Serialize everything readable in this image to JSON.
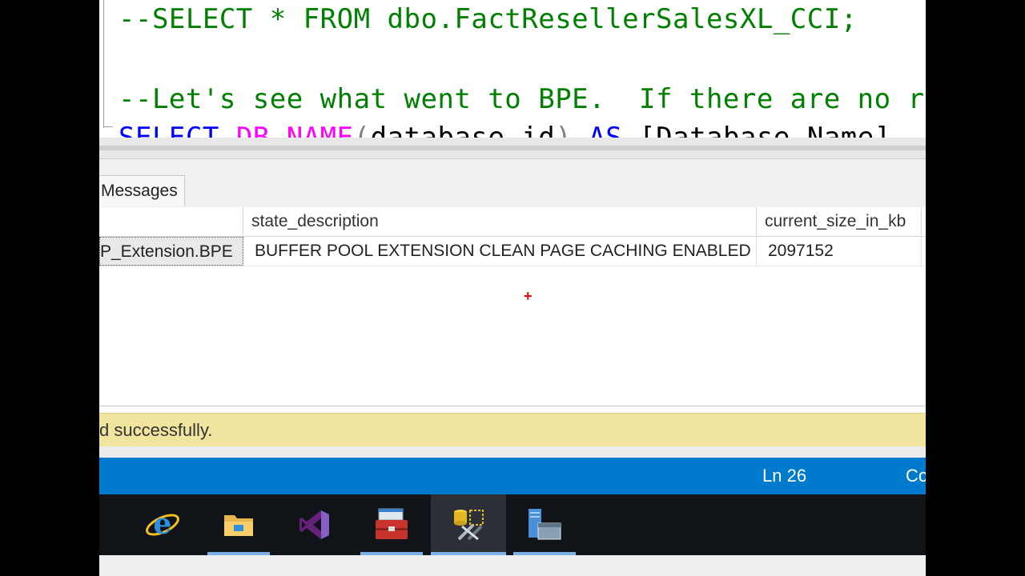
{
  "editor": {
    "line1": "--SELECT * FROM dbo.FactResellerSalesXL_CCI;",
    "line2": "--Let's see what went to BPE.  If there are no re",
    "line3": {
      "kw_select": "SELECT",
      "fn_db_name": "DB_NAME",
      "paren_open": "(",
      "arg": "database_id",
      "paren_close": ")",
      "kw_as": "AS",
      "alias": "[Database_Name]"
    }
  },
  "results": {
    "tabs": [
      {
        "label": "Messages"
      }
    ],
    "columns": [
      "",
      "state_description",
      "current_size_in_kb"
    ],
    "rows": [
      [
        "P_Extension.BPE",
        "BUFFER POOL EXTENSION CLEAN PAGE CACHING ENABLED",
        "2097152"
      ]
    ]
  },
  "status": {
    "message": "d successfully.",
    "line": "Ln 26",
    "col": "Co"
  },
  "taskbar": {
    "items": [
      {
        "icon": "internet-explorer-icon",
        "active": false,
        "pinned": false
      },
      {
        "icon": "file-explorer-icon",
        "active": false,
        "pinned": true
      },
      {
        "icon": "visual-studio-icon",
        "active": false,
        "pinned": false
      },
      {
        "icon": "toolbox-icon",
        "active": false,
        "pinned": true
      },
      {
        "icon": "sql-management-studio-icon",
        "active": true,
        "pinned": true
      },
      {
        "icon": "server-manager-icon",
        "active": false,
        "pinned": true
      }
    ]
  },
  "colors": {
    "comment": "#008000",
    "keyword": "#0000ff",
    "function": "#ff00ff",
    "status_bar": "#007acc",
    "success_bar": "#f1e49e",
    "taskbar_accent": "#7cb1e6"
  }
}
